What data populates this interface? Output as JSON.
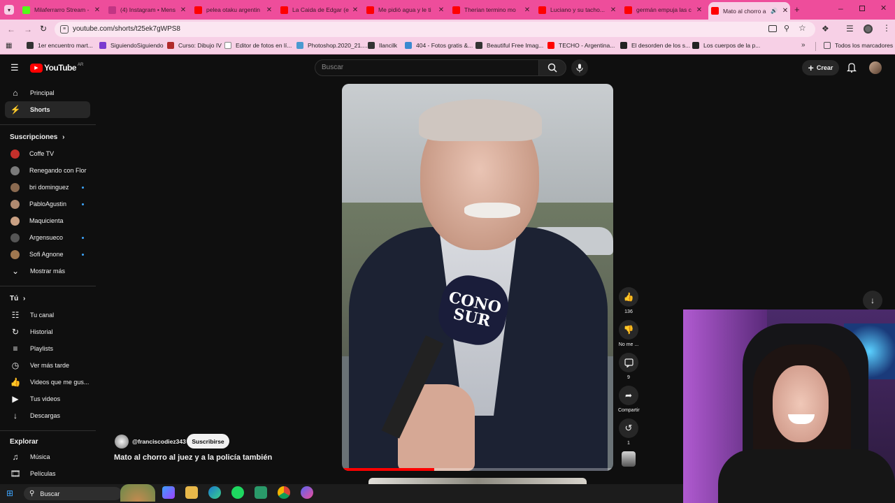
{
  "browser": {
    "tabs": [
      {
        "title": "Milaferrarro Stream - ",
        "color": "#53fc18"
      },
      {
        "title": "(4) Instagram • Mens",
        "color": "#c13584"
      },
      {
        "title": "pelea otaku argentin",
        "color": "#ff0000"
      },
      {
        "title": "La Caida de Edgar (e",
        "color": "#ff0000"
      },
      {
        "title": "Me pidió agua y le ti",
        "color": "#ff0000"
      },
      {
        "title": "Therian termino mo",
        "color": "#ff0000"
      },
      {
        "title": "Luciano y su tacho...",
        "color": "#ff0000"
      },
      {
        "title": "germán empuja las c",
        "color": "#ff0000"
      },
      {
        "title": "Mato al chorro a",
        "color": "#ff0000"
      }
    ],
    "url": "youtube.com/shorts/t25ek7gWPS8",
    "bookmarks": [
      "1er encuentro mart...",
      "SiguiendoSiguiendo",
      "Curso: Dibujo IV",
      "Editor de fotos en lí...",
      "Photoshop.2020_21....",
      "Ilancilk",
      "404 - Fotos gratis &...",
      "Beautiful Free Imag...",
      "TECHO - Argentina...",
      "El desorden de los s...",
      "Los cuerpos de la p..."
    ],
    "all_bookmarks": "Todos los marcadores"
  },
  "youtube": {
    "logo": "YouTube",
    "country": "AR",
    "search_placeholder": "Buscar",
    "create": "Crear",
    "nav": {
      "home": "Principal",
      "shorts": "Shorts"
    },
    "subs_title": "Suscripciones",
    "subscriptions": [
      {
        "name": "Coffe TV",
        "color": "#c4302b",
        "dot": false
      },
      {
        "name": "Renegando con Flor",
        "color": "#7a7a7a",
        "dot": false
      },
      {
        "name": "bri dominguez",
        "color": "#8a6a50",
        "dot": true
      },
      {
        "name": "PabloAgustin",
        "color": "#b08a70",
        "dot": true
      },
      {
        "name": "Maquicienta",
        "color": "#c9a083",
        "dot": false
      },
      {
        "name": "Argensueco",
        "color": "#555555",
        "dot": true
      },
      {
        "name": "Sofi Agnone",
        "color": "#a07850",
        "dot": true
      }
    ],
    "show_more": "Mostrar más",
    "you_title": "Tú",
    "you_items": [
      "Tu canal",
      "Historial",
      "Playlists",
      "Ver más tarde",
      "Videos que me gus...",
      "Tus videos",
      "Descargas"
    ],
    "explore_title": "Explorar",
    "explore_items": [
      "Música",
      "Películas"
    ],
    "short": {
      "channel": "@franciscodiez343",
      "subscribe": "Suscribirse",
      "title": "Mato al chorro al juez y a la policía también",
      "mic_label": "CONO SUR",
      "likes": "136",
      "dislike": "No me ...",
      "comments": "9",
      "share": "Compartir",
      "remix": "1"
    }
  },
  "taskbar": {
    "search": "Buscar"
  }
}
